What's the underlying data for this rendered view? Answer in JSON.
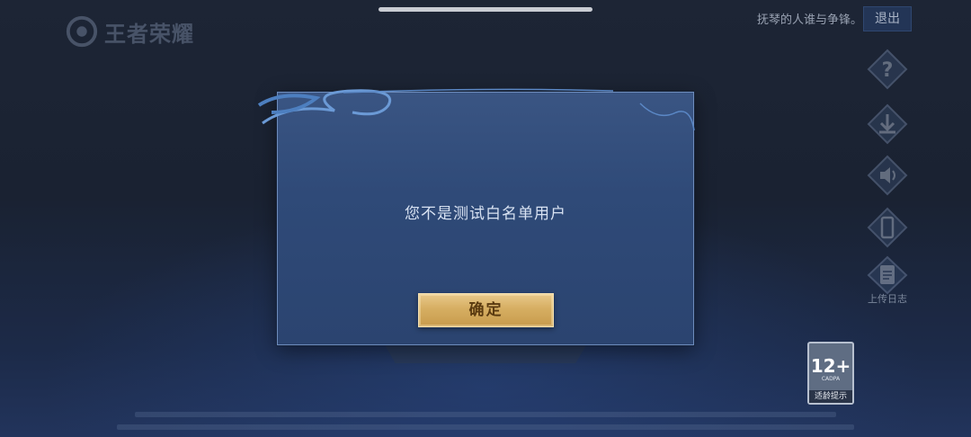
{
  "logo": {
    "text": "王者荣耀"
  },
  "header": {
    "motto": "抚琴的人谁与争锋。",
    "exit_label": "退出"
  },
  "side_menu": {
    "items": [
      {
        "icon": "help-icon"
      },
      {
        "icon": "download-icon"
      },
      {
        "icon": "speaker-icon"
      },
      {
        "icon": "phone-icon"
      },
      {
        "icon": "clipboard-icon",
        "label": "上传日志"
      }
    ]
  },
  "age_rating": {
    "value": "12+",
    "org": "CADPA",
    "tip": "适龄提示"
  },
  "dialog": {
    "message": "您不是测试白名单用户",
    "confirm_label": "确定"
  },
  "colors": {
    "dialog_bg": "#2f4a78",
    "button_gold": "#d6ae62",
    "accent": "#6e8cbc"
  }
}
